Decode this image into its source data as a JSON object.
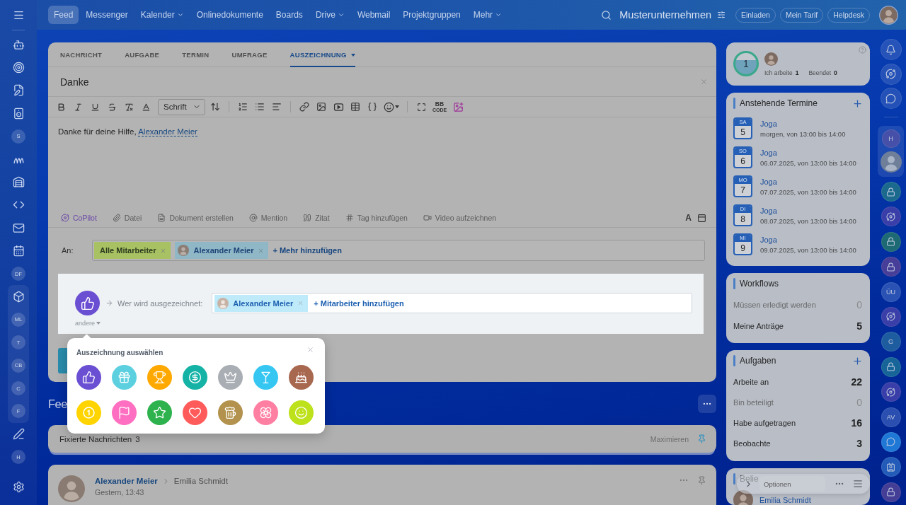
{
  "sidebar": {
    "labels": [
      "S",
      "DF",
      "ML",
      "T",
      "CB",
      "C",
      "F",
      "H"
    ]
  },
  "topbar": {
    "nav": [
      {
        "label": "Feed",
        "selected": true,
        "dropdown": false
      },
      {
        "label": "Messenger",
        "selected": false,
        "dropdown": false
      },
      {
        "label": "Kalender",
        "selected": false,
        "dropdown": true
      },
      {
        "label": "Onlinedokumente",
        "selected": false,
        "dropdown": false
      },
      {
        "label": "Boards",
        "selected": false,
        "dropdown": false
      },
      {
        "label": "Drive",
        "selected": false,
        "dropdown": true
      },
      {
        "label": "Webmail",
        "selected": false,
        "dropdown": false
      },
      {
        "label": "Projektgruppen",
        "selected": false,
        "dropdown": false
      },
      {
        "label": "Mehr",
        "selected": false,
        "dropdown": true
      }
    ],
    "company": "Musterunternehmen",
    "buttons": [
      "Einladen",
      "Mein Tarif",
      "Helpdesk"
    ]
  },
  "composer": {
    "tabs": [
      {
        "label": "NACHRICHT",
        "selected": false,
        "dropdown": false
      },
      {
        "label": "AUFGABE",
        "selected": false,
        "dropdown": false
      },
      {
        "label": "TERMIN",
        "selected": false,
        "dropdown": false
      },
      {
        "label": "UMFRAGE",
        "selected": false,
        "dropdown": false
      },
      {
        "label": "AUSZEICHNUNG",
        "selected": true,
        "dropdown": true
      }
    ],
    "title": "Danke",
    "font_select": "Schrift",
    "bb_code": [
      "BB",
      "CODE"
    ],
    "body": {
      "text": "Danke für deine Hilfe,",
      "mention": "Alexander Meier"
    },
    "actions": [
      {
        "label": "CoPilot",
        "accent": true
      },
      {
        "label": "Datei",
        "accent": false
      },
      {
        "label": "Dokument erstellen",
        "accent": false
      },
      {
        "label": "Mention",
        "accent": false
      },
      {
        "label": "Zitat",
        "accent": false
      },
      {
        "label": "Tag hinzufügen",
        "accent": false
      },
      {
        "label": "Video aufzeichnen",
        "accent": false
      }
    ],
    "text_style": "A",
    "recipients": {
      "label": "An:",
      "tags": [
        {
          "label": "Alle Mitarbeiter",
          "kind": "group"
        },
        {
          "label": "Alexander Meier",
          "kind": "user"
        }
      ],
      "add": "+ Mehr hinzufügen"
    },
    "award": {
      "other": "andere",
      "label": "Wer wird ausgezeichnet:",
      "tags": [
        {
          "label": "Alexander Meier",
          "kind": "user"
        }
      ],
      "add": "+ Mitarbeiter hinzufügen"
    }
  },
  "award_picker": {
    "title": "Auszeichnung auswählen",
    "awards": [
      {
        "color": "#6b4fd3",
        "selected": true
      },
      {
        "color": "#5dd0e0",
        "selected": false
      },
      {
        "color": "#ffa800",
        "selected": false
      },
      {
        "color": "#14b3a6",
        "selected": false
      },
      {
        "color": "#a9aeb4",
        "selected": false
      },
      {
        "color": "#35c6f2",
        "selected": false
      },
      {
        "color": "#a8674f",
        "selected": false
      },
      {
        "color": "#ffd400",
        "selected": false
      },
      {
        "color": "#ff6fc1",
        "selected": false
      },
      {
        "color": "#2db24d",
        "selected": false
      },
      {
        "color": "#ff5b5b",
        "selected": false
      },
      {
        "color": "#b2924c",
        "selected": false
      },
      {
        "color": "#ff7fa3",
        "selected": false
      },
      {
        "color": "#bde11b",
        "selected": false
      }
    ]
  },
  "feed": {
    "title": "Fee",
    "pinned": {
      "label": "Fixierte Nachrichten",
      "count": "3",
      "action": "Maximieren"
    },
    "post": {
      "author": "Alexander Meier",
      "recipient": "Emilia Schmidt",
      "time": "Gestern, 13:43"
    }
  },
  "widgets": {
    "timeman": {
      "count": "1",
      "working_label": "Ich arbeite",
      "working": "1",
      "done_label": "Beendet",
      "done": "0"
    },
    "events": {
      "title": "Anstehende Termine",
      "items": [
        {
          "weekday": "SA",
          "day": "5",
          "title": "Joga",
          "when": "morgen, von 13:00 bis 14:00"
        },
        {
          "weekday": "SO",
          "day": "6",
          "title": "Joga",
          "when": "06.07.2025, von 13:00 bis 14:00"
        },
        {
          "weekday": "MO",
          "day": "7",
          "title": "Joga",
          "when": "07.07.2025, von 13:00 bis 14:00"
        },
        {
          "weekday": "DI",
          "day": "8",
          "title": "Joga",
          "when": "08.07.2025, von 13:00 bis 14:00"
        },
        {
          "weekday": "MI",
          "day": "9",
          "title": "Joga",
          "when": "09.07.2025, von 13:00 bis 14:00"
        }
      ]
    },
    "workflows": {
      "title": "Workflows",
      "rows": [
        {
          "label": "Müssen erledigt werden",
          "value": "0",
          "muted": true
        },
        {
          "label": "Meine Anträge",
          "value": "5",
          "muted": false
        }
      ]
    },
    "tasks": {
      "title": "Aufgaben",
      "rows": [
        {
          "label": "Arbeite an",
          "value": "22",
          "muted": false
        },
        {
          "label": "Bin beteiligt",
          "value": "0",
          "muted": true
        },
        {
          "label": "Habe aufgetragen",
          "value": "16",
          "muted": false
        },
        {
          "label": "Beobachte",
          "value": "3",
          "muted": false
        }
      ]
    },
    "popular": {
      "title": "Belie",
      "person": "Emilia Schmidt"
    }
  },
  "right_rail": {
    "labels": [
      "H",
      "ÜU",
      "G",
      "AV"
    ]
  },
  "options_bar": {
    "placeholder": "Optionen"
  }
}
